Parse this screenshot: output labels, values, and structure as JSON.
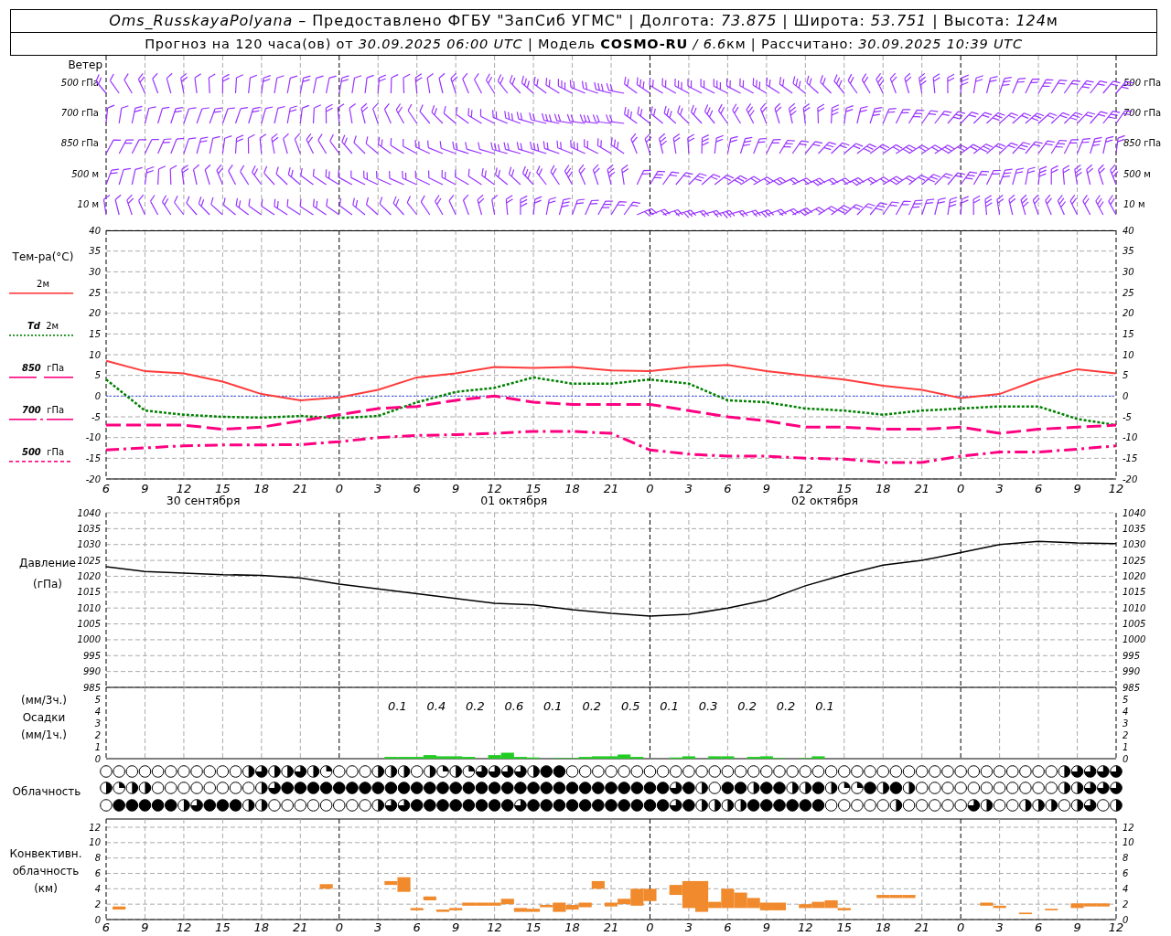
{
  "header": {
    "title": [
      {
        "text": "Oms_RusskayaPolyana",
        "kind": "italic"
      },
      {
        "text": " – Предоставлено ФГБУ \"ЗапСиб УГМС\" | Долгота: ",
        "kind": "plain"
      },
      {
        "text": "73.875",
        "kind": "italic"
      },
      {
        "text": " | Широта: ",
        "kind": "plain"
      },
      {
        "text": "53.751",
        "kind": "italic"
      },
      {
        "text": " | Высота: ",
        "kind": "plain"
      },
      {
        "text": "124",
        "kind": "italic"
      },
      {
        "text": "м",
        "kind": "plain"
      }
    ],
    "subtitle": [
      {
        "text": "Прогноз на 120 часа(ов) от ",
        "kind": "plain"
      },
      {
        "text": "30.09.2025 06:00 UTC",
        "kind": "italic"
      },
      {
        "text": " | Модель ",
        "kind": "plain"
      },
      {
        "text": "COSMO-RU",
        "kind": "bold"
      },
      {
        "text": " / 6.6",
        "kind": "italic"
      },
      {
        "text": "км | Рассчитано: ",
        "kind": "plain"
      },
      {
        "text": "30.09.2025 10:39 UTC",
        "kind": "italic"
      }
    ]
  },
  "wind": {
    "title": "Ветер",
    "levels": [
      {
        "value": "500",
        "unit": "гПа"
      },
      {
        "value": "700",
        "unit": "гПа"
      },
      {
        "value": "850",
        "unit": "гПа"
      },
      {
        "value": "500",
        "unit": "м"
      },
      {
        "value": "10",
        "unit": "м"
      }
    ],
    "levels_right": [
      {
        "value": "500",
        "unit": "гПа"
      },
      {
        "value": "700",
        "unit": "гПа"
      },
      {
        "value": "850",
        "unit": "гПа"
      },
      {
        "value": "500",
        "unit": "м"
      },
      {
        "value": "10",
        "unit": "м"
      }
    ]
  },
  "temperature": {
    "title": "Тем-ра(°C)",
    "legend": [
      {
        "unit": "2м",
        "kind": "solid",
        "color": "#ff3b3b"
      },
      {
        "name": "Td",
        "unit": "2м",
        "kind": "dotted",
        "color": "#008000"
      },
      {
        "name": "850",
        "unit": "гПа",
        "kind": "dash",
        "color": "#ff0080"
      },
      {
        "name": "700",
        "unit": "гПа",
        "kind": "dashdot",
        "color": "#ff0080"
      },
      {
        "name": "500",
        "unit": "гПа",
        "kind": "shortdash",
        "color": "#ff0080"
      }
    ],
    "dates": [
      "30 сентября",
      "01 октября",
      "02 октября"
    ],
    "right_yticks": [
      "40",
      "35",
      "30",
      "25",
      "20",
      "15",
      "10",
      "5",
      "0",
      "-5",
      "-10",
      "-15",
      "-20"
    ],
    "chart_data": {
      "type": "line",
      "grid": true,
      "categories": [
        "6",
        "9",
        "12",
        "15",
        "18",
        "21",
        "0",
        "3",
        "6",
        "9",
        "12",
        "15",
        "18",
        "21",
        "0",
        "3",
        "6",
        "9",
        "12",
        "15",
        "18",
        "21",
        "0",
        "3",
        "6",
        "9",
        "12"
      ],
      "ylim": [
        -20,
        40
      ],
      "yticks": [
        -20,
        -15,
        -10,
        -5,
        0,
        5,
        10,
        15,
        20,
        25,
        30,
        35,
        40
      ],
      "ref_lines": [
        {
          "axis": "y",
          "value": 0,
          "color": "#3050ff"
        }
      ],
      "series": [
        {
          "color": "#ff3b3b",
          "line_style": "solid",
          "values": [
            8.5,
            6,
            5.5,
            3.5,
            0.5,
            -1,
            -0.3,
            1.5,
            4.5,
            5.5,
            7,
            6.8,
            7,
            6.2,
            6,
            7,
            7.5,
            6,
            5,
            4,
            2.5,
            1.5,
            -0.5,
            0.5,
            4,
            6.5,
            5.5
          ]
        },
        {
          "color": "#008000",
          "line_style": "dotted",
          "values": [
            4,
            -3.5,
            -4.5,
            -5,
            -5.2,
            -4.8,
            -5.3,
            -4.8,
            -1.5,
            1,
            2,
            4.5,
            3,
            3,
            4,
            3,
            -1,
            -1.5,
            -3,
            -3.5,
            -4.5,
            -3.5,
            -3,
            -2.5,
            -2.5,
            -5.5,
            -7
          ]
        },
        {
          "color": "#ff0080",
          "line_style": "dashed",
          "values": [
            -7,
            -7,
            -7,
            -8,
            -7.5,
            -6,
            -4.5,
            -3,
            -2.5,
            -1,
            0,
            -1.5,
            -2,
            -2,
            -2,
            -3.5,
            -5,
            -6,
            -7.5,
            -7.5,
            -8,
            -8,
            -7.5,
            -9,
            -8,
            -7.5,
            -7
          ]
        },
        {
          "color": "#ff0080",
          "line_style": "dashdot",
          "values": [
            -13,
            -12.5,
            -12,
            -11.8,
            -11.8,
            -11.7,
            -11,
            -10,
            -9.5,
            -9.3,
            -9,
            -8.5,
            -8.5,
            -9,
            -13,
            -14,
            -14.5,
            -14.5,
            -15,
            -15.2,
            -16,
            -16,
            -14.5,
            -13.5,
            -13.5,
            -12.8,
            -12
          ]
        }
      ]
    }
  },
  "pressure": {
    "title": "Давление",
    "unit": "(гПа)",
    "right_yticks": [
      "1040",
      "1035",
      "1030",
      "1025",
      "1020",
      "1015",
      "1010",
      "1005",
      "1000",
      "995",
      "990",
      "985"
    ],
    "chart_data": {
      "type": "line",
      "grid": true,
      "categories": [
        null,
        null,
        null,
        null,
        null,
        null,
        null,
        null,
        null,
        null,
        null,
        null,
        null,
        null,
        null,
        null,
        null,
        null,
        null,
        null,
        null,
        null,
        null,
        null,
        null,
        null,
        null
      ],
      "ylim": [
        985,
        1040
      ],
      "yticks": [
        985,
        990,
        995,
        1000,
        1005,
        1010,
        1015,
        1020,
        1025,
        1030,
        1035,
        1040
      ],
      "series": [
        {
          "color": "#000000",
          "values": [
            1023,
            1021.5,
            1021,
            1020.5,
            1020.3,
            1019.5,
            1017.5,
            1016,
            1014.5,
            1013,
            1011.5,
            1011,
            1009.5,
            1008.3,
            1007.5,
            1008,
            1010,
            1012.5,
            1017,
            1020.5,
            1023.5,
            1025,
            1027.5,
            1030,
            1031,
            1030.5,
            1030.3
          ]
        }
      ]
    }
  },
  "precipitation": {
    "labels": [
      "(мм/3ч.)",
      "Осадки",
      "(мм/1ч.)"
    ],
    "right_yticks": [
      "5",
      "4",
      "3",
      "2",
      "1",
      "0"
    ],
    "totals": [
      "0.1",
      "0.4",
      "0.2",
      "0.6",
      "0.1",
      "0.2",
      "0.5",
      "0.1",
      "0.3",
      "0.2",
      "0.2",
      "0.1"
    ],
    "chart_data": {
      "type": "bar",
      "grid": true,
      "categories": [
        null,
        null,
        null,
        null,
        null,
        null,
        null,
        null,
        null,
        null,
        null,
        null,
        null,
        null,
        null,
        null,
        null,
        null,
        null,
        null,
        null,
        null,
        null,
        null,
        null,
        null,
        null,
        null,
        null,
        null,
        null,
        null,
        null,
        null,
        null,
        null,
        null,
        null,
        null,
        null,
        null,
        null,
        null,
        null,
        null,
        null,
        null,
        null,
        null,
        null,
        null,
        null,
        null,
        null,
        null,
        null,
        null,
        null,
        null,
        null,
        null,
        null,
        null,
        null,
        null,
        null,
        null,
        null,
        null,
        null,
        null,
        null,
        null,
        null,
        null,
        null,
        null,
        null,
        null
      ],
      "ylim": [
        0,
        6
      ],
      "yticks": [
        0,
        1,
        2,
        3,
        4,
        5
      ],
      "series": [
        {
          "color": "#22cc22",
          "values": [
            null,
            null,
            null,
            null,
            null,
            null,
            null,
            null,
            null,
            null,
            null,
            null,
            null,
            null,
            null,
            null,
            null,
            null,
            null,
            null,
            null,
            null,
            0.15,
            0.15,
            0.15,
            0.3,
            0.2,
            0.2,
            0.15,
            null,
            0.3,
            0.5,
            0.15,
            0.1,
            null,
            0.05,
            0.05,
            0.15,
            0.2,
            0.2,
            0.35,
            0.15,
            null,
            null,
            0.1,
            0.2,
            null,
            0.2,
            0.2,
            null,
            0.15,
            0.2,
            0.05,
            null,
            0.05,
            0.2,
            null,
            null,
            null,
            null,
            null,
            null,
            null,
            null,
            null,
            null,
            null,
            null,
            null,
            null,
            null,
            null,
            null,
            null,
            null,
            null,
            null,
            null,
            null
          ]
        }
      ]
    }
  },
  "cloudiness": {
    "label": "Облачность",
    "rows": [
      {
        "cells": [
          {
            "kind": "clear"
          },
          {
            "kind": "clear"
          },
          {
            "kind": "clear"
          },
          {
            "kind": "clear"
          },
          {
            "kind": "clear"
          },
          {
            "kind": "clear"
          },
          {
            "kind": "clear"
          },
          {
            "kind": "clear"
          },
          {
            "kind": "clear"
          },
          {
            "kind": "clear"
          },
          {
            "kind": "clear"
          },
          {
            "kind": "half"
          },
          {
            "kind": "threequarter"
          },
          {
            "kind": "half"
          },
          {
            "kind": "half"
          },
          {
            "kind": "threequarter"
          },
          {
            "kind": "half"
          },
          {
            "kind": "quarter"
          },
          {
            "kind": "clear"
          },
          {
            "kind": "clear"
          },
          {
            "kind": "clear"
          },
          {
            "kind": "half"
          },
          {
            "kind": "half"
          },
          {
            "kind": "half"
          },
          {
            "kind": "clear"
          },
          {
            "kind": "half"
          },
          {
            "kind": "quarter"
          },
          {
            "kind": "half"
          },
          {
            "kind": "quarter"
          },
          {
            "kind": "threequarter"
          },
          {
            "kind": "threequarter"
          },
          {
            "kind": "threequarter"
          },
          {
            "kind": "threequarter"
          },
          {
            "kind": "half"
          },
          {
            "kind": "overcast"
          },
          {
            "kind": "overcast"
          },
          {
            "kind": "clear"
          },
          {
            "kind": "clear"
          },
          {
            "kind": "clear"
          },
          {
            "kind": "clear"
          },
          {
            "kind": "clear"
          },
          {
            "kind": "clear"
          },
          {
            "kind": "clear"
          },
          {
            "kind": "clear"
          },
          {
            "kind": "clear"
          },
          {
            "kind": "clear"
          },
          {
            "kind": "clear"
          },
          {
            "kind": "clear"
          },
          {
            "kind": "clear"
          },
          {
            "kind": "clear"
          },
          {
            "kind": "clear"
          },
          {
            "kind": "clear"
          },
          {
            "kind": "clear"
          },
          {
            "kind": "clear"
          },
          {
            "kind": "clear"
          },
          {
            "kind": "clear"
          },
          {
            "kind": "clear"
          },
          {
            "kind": "clear"
          },
          {
            "kind": "clear"
          },
          {
            "kind": "clear"
          },
          {
            "kind": "clear"
          },
          {
            "kind": "clear"
          },
          {
            "kind": "clear"
          },
          {
            "kind": "clear"
          },
          {
            "kind": "clear"
          },
          {
            "kind": "clear"
          },
          {
            "kind": "clear"
          },
          {
            "kind": "clear"
          },
          {
            "kind": "clear"
          },
          {
            "kind": "clear"
          },
          {
            "kind": "clear"
          },
          {
            "kind": "clear"
          },
          {
            "kind": "clear"
          },
          {
            "kind": "clear"
          },
          {
            "kind": "half"
          },
          {
            "kind": "threequarter"
          },
          {
            "kind": "threequarter"
          },
          {
            "kind": "threequarter"
          },
          {
            "kind": "threequarter"
          }
        ]
      },
      {
        "cells": [
          {
            "kind": "half"
          },
          {
            "kind": "quarter"
          },
          {
            "kind": "half"
          },
          {
            "kind": "half"
          },
          {
            "kind": "clear"
          },
          {
            "kind": "clear"
          },
          {
            "kind": "clear"
          },
          {
            "kind": "clear"
          },
          {
            "kind": "clear"
          },
          {
            "kind": "clear"
          },
          {
            "kind": "clear"
          },
          {
            "kind": "clear"
          },
          {
            "kind": "half"
          },
          {
            "kind": "threequarter"
          },
          {
            "kind": "overcast"
          },
          {
            "kind": "overcast"
          },
          {
            "kind": "overcast"
          },
          {
            "kind": "overcast"
          },
          {
            "kind": "overcast"
          },
          {
            "kind": "overcast"
          },
          {
            "kind": "overcast"
          },
          {
            "kind": "overcast"
          },
          {
            "kind": "overcast"
          },
          {
            "kind": "overcast"
          },
          {
            "kind": "overcast"
          },
          {
            "kind": "overcast"
          },
          {
            "kind": "overcast"
          },
          {
            "kind": "overcast"
          },
          {
            "kind": "overcast"
          },
          {
            "kind": "overcast"
          },
          {
            "kind": "overcast"
          },
          {
            "kind": "overcast"
          },
          {
            "kind": "overcast"
          },
          {
            "kind": "overcast"
          },
          {
            "kind": "overcast"
          },
          {
            "kind": "overcast"
          },
          {
            "kind": "overcast"
          },
          {
            "kind": "overcast"
          },
          {
            "kind": "overcast"
          },
          {
            "kind": "overcast"
          },
          {
            "kind": "overcast"
          },
          {
            "kind": "overcast"
          },
          {
            "kind": "overcast"
          },
          {
            "kind": "overcast"
          },
          {
            "kind": "threequarter"
          },
          {
            "kind": "overcast"
          },
          {
            "kind": "half"
          },
          {
            "kind": "clear"
          },
          {
            "kind": "overcast"
          },
          {
            "kind": "overcast"
          },
          {
            "kind": "half"
          },
          {
            "kind": "overcast"
          },
          {
            "kind": "overcast"
          },
          {
            "kind": "half"
          },
          {
            "kind": "half"
          },
          {
            "kind": "overcast"
          },
          {
            "kind": "half"
          },
          {
            "kind": "quarter"
          },
          {
            "kind": "quarter"
          },
          {
            "kind": "overcast"
          },
          {
            "kind": "half"
          },
          {
            "kind": "overcast"
          },
          {
            "kind": "half"
          },
          {
            "kind": "clear"
          },
          {
            "kind": "clear"
          },
          {
            "kind": "clear"
          },
          {
            "kind": "clear"
          },
          {
            "kind": "clear"
          },
          {
            "kind": "clear"
          },
          {
            "kind": "clear"
          },
          {
            "kind": "clear"
          },
          {
            "kind": "clear"
          },
          {
            "kind": "clear"
          },
          {
            "kind": "clear"
          },
          {
            "kind": "half"
          },
          {
            "kind": "half"
          },
          {
            "kind": "threequarter"
          },
          {
            "kind": "threequarter"
          },
          {
            "kind": "threequarter"
          }
        ]
      },
      {
        "cells": [
          {
            "kind": "clear"
          },
          {
            "kind": "overcast"
          },
          {
            "kind": "overcast"
          },
          {
            "kind": "overcast"
          },
          {
            "kind": "overcast"
          },
          {
            "kind": "overcast"
          },
          {
            "kind": "half"
          },
          {
            "kind": "threequarter"
          },
          {
            "kind": "overcast"
          },
          {
            "kind": "overcast"
          },
          {
            "kind": "overcast"
          },
          {
            "kind": "half"
          },
          {
            "kind": "half"
          },
          {
            "kind": "clear"
          },
          {
            "kind": "clear"
          },
          {
            "kind": "clear"
          },
          {
            "kind": "clear"
          },
          {
            "kind": "clear"
          },
          {
            "kind": "clear"
          },
          {
            "kind": "clear"
          },
          {
            "kind": "clear"
          },
          {
            "kind": "half"
          },
          {
            "kind": "threequarter"
          },
          {
            "kind": "threequarter"
          },
          {
            "kind": "overcast"
          },
          {
            "kind": "overcast"
          },
          {
            "kind": "overcast"
          },
          {
            "kind": "overcast"
          },
          {
            "kind": "overcast"
          },
          {
            "kind": "overcast"
          },
          {
            "kind": "overcast"
          },
          {
            "kind": "overcast"
          },
          {
            "kind": "threequarter"
          },
          {
            "kind": "overcast"
          },
          {
            "kind": "overcast"
          },
          {
            "kind": "overcast"
          },
          {
            "kind": "overcast"
          },
          {
            "kind": "overcast"
          },
          {
            "kind": "overcast"
          },
          {
            "kind": "overcast"
          },
          {
            "kind": "overcast"
          },
          {
            "kind": "overcast"
          },
          {
            "kind": "overcast"
          },
          {
            "kind": "overcast"
          },
          {
            "kind": "threequarter"
          },
          {
            "kind": "overcast"
          },
          {
            "kind": "half"
          },
          {
            "kind": "half"
          },
          {
            "kind": "half"
          },
          {
            "kind": "half"
          },
          {
            "kind": "overcast"
          },
          {
            "kind": "overcast"
          },
          {
            "kind": "overcast"
          },
          {
            "kind": "overcast"
          },
          {
            "kind": "overcast"
          },
          {
            "kind": "overcast"
          },
          {
            "kind": "clear"
          },
          {
            "kind": "clear"
          },
          {
            "kind": "clear"
          },
          {
            "kind": "clear"
          },
          {
            "kind": "clear"
          },
          {
            "kind": "half"
          },
          {
            "kind": "clear"
          },
          {
            "kind": "clear"
          },
          {
            "kind": "clear"
          },
          {
            "kind": "clear"
          },
          {
            "kind": "clear"
          },
          {
            "kind": "threequarter"
          },
          {
            "kind": "half"
          },
          {
            "kind": "clear"
          },
          {
            "kind": "clear"
          },
          {
            "kind": "half"
          },
          {
            "kind": "half"
          },
          {
            "kind": "half"
          },
          {
            "kind": "clear"
          },
          {
            "kind": "half"
          },
          {
            "kind": "threequarter"
          },
          {
            "kind": "clear"
          },
          {
            "kind": "half"
          }
        ]
      }
    ]
  },
  "convective": {
    "labels": [
      "Конвективн.",
      "облачность",
      "(км)"
    ],
    "right_yticks": [
      "12",
      "10",
      "8",
      "6",
      "4",
      "2",
      "0"
    ],
    "chart_data": {
      "type": "bar",
      "grid": true,
      "ylim": [
        0,
        12
      ],
      "yticks": [
        0,
        2,
        4,
        6,
        8,
        10,
        12
      ],
      "categories": [
        "6",
        null,
        null,
        "9",
        null,
        null,
        "12",
        null,
        null,
        "15",
        null,
        null,
        "18",
        null,
        null,
        "21",
        null,
        null,
        "0",
        null,
        null,
        "3",
        null,
        null,
        "6",
        null,
        null,
        "9",
        null,
        null,
        "12",
        null,
        null,
        "15",
        null,
        null,
        "18",
        null,
        null,
        "21",
        null,
        null,
        "0",
        null,
        null,
        "3",
        null,
        null,
        "6",
        null,
        null,
        "9",
        null,
        null,
        "12",
        null,
        null,
        "15",
        null,
        null,
        "18",
        null,
        null,
        "21",
        null,
        null,
        "0",
        null,
        null,
        "3",
        null,
        null,
        "6",
        null,
        null,
        "9",
        null,
        null,
        "12"
      ],
      "series": [
        {
          "color": "#f08a2c",
          "base": [
            null,
            1.3,
            null,
            null,
            null,
            null,
            null,
            null,
            null,
            null,
            null,
            null,
            null,
            null,
            null,
            null,
            null,
            4,
            null,
            null,
            null,
            null,
            4.5,
            3.6,
            1.2,
            2.5,
            1,
            1.2,
            1.8,
            1.8,
            1.8,
            2,
            1,
            1,
            1.6,
            1,
            1.3,
            1.6,
            4,
            1.7,
            2,
            1.8,
            2.4,
            null,
            3.2,
            1.5,
            1,
            1.5,
            1.5,
            1.5,
            1.5,
            1.2,
            1.2,
            null,
            1.5,
            1.5,
            1.5,
            1.2,
            null,
            null,
            2.8,
            2.8,
            2.8,
            null,
            null,
            null,
            null,
            null,
            1.8,
            1.5,
            null,
            0.7,
            null,
            1.2,
            null,
            1.5,
            1.7,
            1.7,
            null
          ],
          "values": [
            null,
            0.4,
            null,
            null,
            null,
            null,
            null,
            null,
            null,
            null,
            null,
            null,
            null,
            null,
            null,
            null,
            null,
            0.6,
            null,
            null,
            null,
            null,
            0.5,
            1.9,
            0.3,
            0.5,
            0.3,
            0.3,
            0.4,
            0.4,
            0.4,
            0.7,
            0.5,
            0.4,
            0.3,
            1.2,
            0.6,
            0.6,
            1,
            0.5,
            0.7,
            2.2,
            1.6,
            null,
            1.3,
            3.5,
            4,
            0.8,
            2.5,
            2,
            1.3,
            1,
            1,
            null,
            0.5,
            0.8,
            1,
            0.3,
            null,
            null,
            0.4,
            0.4,
            0.4,
            null,
            null,
            null,
            null,
            null,
            0.4,
            0.3,
            null,
            0.2,
            null,
            0.2,
            null,
            0.6,
            0.4,
            0.4,
            null
          ]
        }
      ]
    }
  }
}
